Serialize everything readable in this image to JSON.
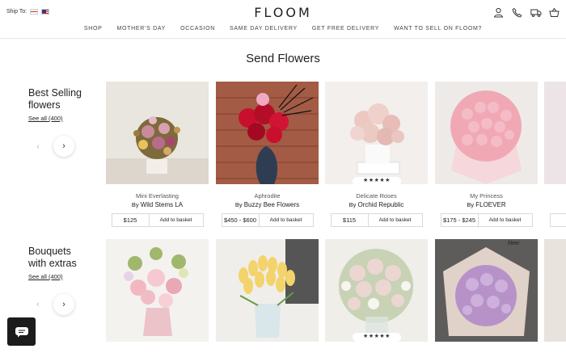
{
  "header": {
    "ship_to": "Ship To:",
    "logo": "FLOOM",
    "icons": [
      "user-icon",
      "phone-icon",
      "truck-icon",
      "basket-icon"
    ],
    "nav": [
      "SHOP",
      "MOTHER'S DAY",
      "OCCASION",
      "SAME DAY DELIVERY",
      "GET FREE DELIVERY",
      "WANT TO SELL ON FLOOM?"
    ]
  },
  "page_title": "Send Flowers",
  "sections": [
    {
      "title_line1": "Best Selling",
      "title_line2": "flowers",
      "see_all": "See all (400)",
      "cards": [
        {
          "name": "Mini Everlasting",
          "by": "By",
          "seller": "Wild Stems LA",
          "price": "$125",
          "add": "Add to basket"
        },
        {
          "name": "Aphrodite",
          "by": "By",
          "seller": "Buzzy Bee Flowers",
          "price": "$450 - $600",
          "add": "Add to basket"
        },
        {
          "name": "Delicate Roses",
          "by": "By",
          "seller": "Orchid Republic",
          "price": "$115",
          "add": "Add to basket",
          "stars": "★★★★★"
        },
        {
          "name": "My Princess",
          "by": "By",
          "seller": "FLOEVER",
          "price": "$175 - $245",
          "add": "Add to basket"
        }
      ]
    },
    {
      "title_line1": "Bouquets",
      "title_line2": "with extras",
      "see_all": "See all (400)",
      "cards": [
        {
          "stars": "",
          "badge": ""
        },
        {
          "stars": "",
          "badge": ""
        },
        {
          "stars": "★★★★★",
          "badge": ""
        },
        {
          "stars": "",
          "badge": "New"
        }
      ]
    }
  ],
  "colors": {
    "text": "#222222",
    "chat_button": "#1c1c1c",
    "border": "#d9d9d9"
  }
}
